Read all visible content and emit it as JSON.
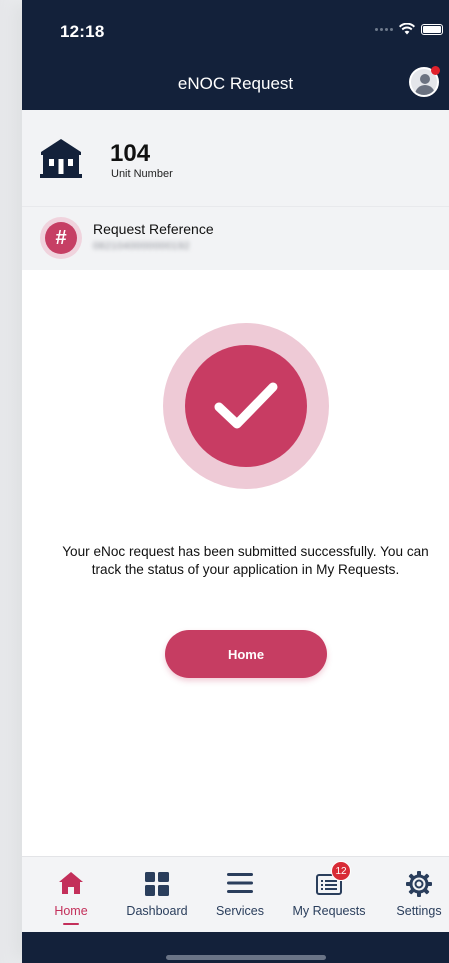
{
  "status_bar": {
    "time": "12:18"
  },
  "header": {
    "title": "eNOC Request"
  },
  "unit": {
    "number": "104",
    "label": "Unit Number"
  },
  "request": {
    "label": "Request Reference",
    "value": "0821040000000192",
    "hash_symbol": "#"
  },
  "success": {
    "message": "Your eNoc request has been submitted successfully. You can track the status of your application in My Requests.",
    "home_button_label": "Home"
  },
  "tabs": [
    {
      "label": "Home",
      "icon": "home-icon",
      "active": true
    },
    {
      "label": "Dashboard",
      "icon": "dashboard-icon"
    },
    {
      "label": "Services",
      "icon": "menu-icon"
    },
    {
      "label": "My Requests",
      "icon": "requests-icon",
      "badge": "12"
    },
    {
      "label": "Settings",
      "icon": "gear-icon"
    }
  ],
  "colors": {
    "navy": "#13213a",
    "accent": "#c63d62",
    "accent_light": "#eecad6"
  }
}
